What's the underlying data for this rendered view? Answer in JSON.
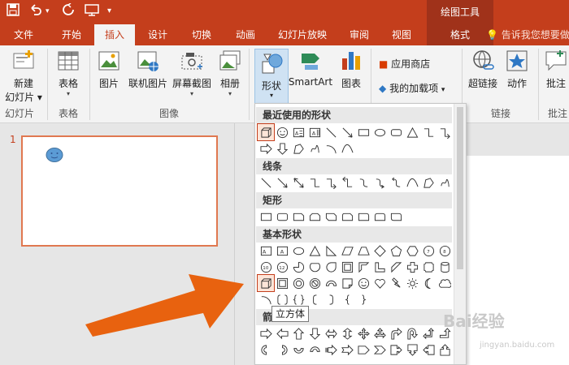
{
  "titlebar": {
    "context_title": "绘图工具",
    "quick_access": [
      "save-icon",
      "undo-icon",
      "redo-icon",
      "present-icon",
      "customize-icon"
    ]
  },
  "tabs": [
    {
      "label": "文件"
    },
    {
      "label": "开始"
    },
    {
      "label": "插入"
    },
    {
      "label": "设计"
    },
    {
      "label": "切换"
    },
    {
      "label": "动画"
    },
    {
      "label": "幻灯片放映"
    },
    {
      "label": "审阅"
    },
    {
      "label": "视图"
    },
    {
      "label": "格式"
    }
  ],
  "tell_me": "告诉我您想要做",
  "ribbon": {
    "new_slide": "新建\n幻灯片",
    "new_slide_l1": "新建",
    "new_slide_l2": "幻灯片",
    "table": "表格",
    "picture": "图片",
    "online_picture": "联机图片",
    "screenshot": "屏幕截图",
    "album": "相册",
    "shapes": "形状",
    "smartart": "SmartArt",
    "chart": "图表",
    "store": "应用商店",
    "my_addins": "我的加载项",
    "hyperlink": "超链接",
    "action": "动作",
    "comment": "批注",
    "groups": {
      "slides": "幻灯片",
      "tables": "表格",
      "images": "图像",
      "links": "链接",
      "comments": "批注"
    }
  },
  "slide_number": "1",
  "gallery": {
    "recent": "最近使用的形状",
    "lines": "线条",
    "rectangles": "矩形",
    "basic": "基本形状",
    "block_arrows_partial": "箭"
  },
  "tooltip": "立方体",
  "watermark": "Bai经验",
  "watermark_sub": "jingyan.baidu.com",
  "colors": {
    "accent": "#c43e1c",
    "context_tab": "#a0321a",
    "arrow": "#e8620f",
    "smiley": "#5b9bd5"
  }
}
